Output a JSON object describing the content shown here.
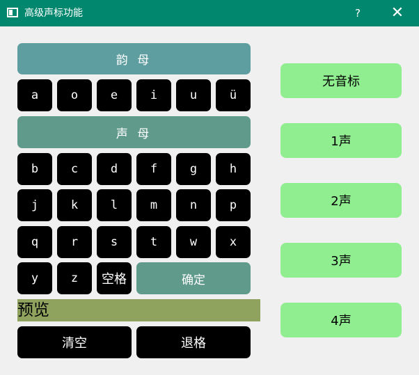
{
  "window": {
    "title": "高级声标功能",
    "help_label": "?",
    "close_label": "✕"
  },
  "vowels": {
    "header": "韵 母",
    "keys": [
      "a",
      "o",
      "e",
      "i",
      "u",
      "ü"
    ]
  },
  "consonants": {
    "header": "声 母",
    "rows": [
      [
        "b",
        "c",
        "d",
        "f",
        "g",
        "h"
      ],
      [
        "j",
        "k",
        "l",
        "m",
        "n",
        "p"
      ],
      [
        "q",
        "r",
        "s",
        "t",
        "w",
        "x"
      ],
      [
        "y",
        "z"
      ]
    ],
    "space_label": "空格",
    "confirm_label": "确定"
  },
  "preview": {
    "text": "预览"
  },
  "actions": {
    "clear_label": "清空",
    "backspace_label": "退格"
  },
  "tones": [
    "无音标",
    "1声",
    "2声",
    "3声",
    "4声"
  ],
  "colors": {
    "titlebar": "#00876e",
    "vowel_header": "#5f9ea0",
    "consonant_header": "#5f9a8a",
    "key": "#000000",
    "preview": "#8fa35f",
    "tone_button": "#90ee90",
    "background": "#f0f0f0"
  }
}
